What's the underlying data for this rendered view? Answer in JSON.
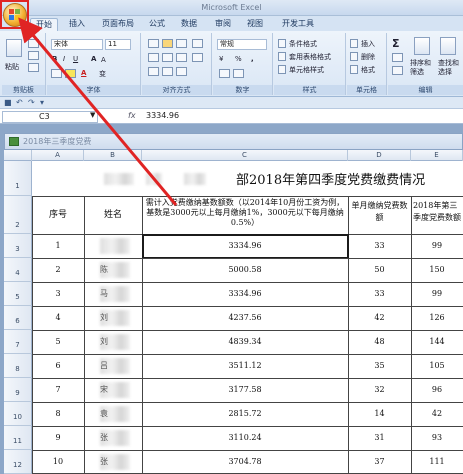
{
  "window": {
    "title": "Microsoft Excel"
  },
  "tabs": [
    "开始",
    "插入",
    "页面布局",
    "公式",
    "数据",
    "审阅",
    "视图",
    "开发工具"
  ],
  "ribbon": {
    "clipboard": {
      "label": "剪贴板",
      "paste": "粘贴"
    },
    "font": {
      "label": "字体",
      "name": "宋体",
      "size": "11",
      "bold": "B",
      "italic": "I",
      "underline": "U",
      "color_letter": "A",
      "grow": "A",
      "shrink": "A",
      "wen": "变"
    },
    "alignment": {
      "label": "对齐方式"
    },
    "number": {
      "label": "数字",
      "format": "常规",
      "currency": "¥",
      "percent": "%",
      "comma": ","
    },
    "styles": {
      "label": "样式",
      "conditional": "条件格式",
      "table": "套用表格格式",
      "cell_styles": "单元格样式"
    },
    "cells": {
      "label": "单元格",
      "insert": "插入",
      "delete": "删除",
      "format": "格式"
    },
    "editing": {
      "label": "编辑",
      "sort": "排序和筛选",
      "find": "查找和选择",
      "sigma": "Σ"
    }
  },
  "formula_bar": {
    "name_box": "C3",
    "fx": "fx",
    "value": "3334.96"
  },
  "workbook": {
    "title": "2018年三季度党费"
  },
  "columns": [
    "A",
    "B",
    "C",
    "D",
    "E"
  ],
  "rows": [
    "1",
    "2",
    "3",
    "4",
    "5",
    "6",
    "7",
    "8",
    "9",
    "10",
    "11",
    "12"
  ],
  "sheet": {
    "title_visible": "部2018年第四季度党费缴费情况",
    "header": {
      "a": "序号",
      "b": "姓名",
      "c": "需计入党费缴纳基数额数（以2014年10月份工资为例，基数是3000元以上每月缴纳1%，3000元以下每月缴纳0.5%）",
      "d": "单月缴纳党费数额",
      "e": "2018年第三季度党费数额"
    },
    "records": [
      {
        "no": "1",
        "name": "",
        "base": "3334.96",
        "monthly": "33",
        "quarter": "99"
      },
      {
        "no": "2",
        "name": "陈",
        "base": "5000.58",
        "monthly": "50",
        "quarter": "150"
      },
      {
        "no": "3",
        "name": "马",
        "base": "3334.96",
        "monthly": "33",
        "quarter": "99"
      },
      {
        "no": "4",
        "name": "刘",
        "base": "4237.56",
        "monthly": "42",
        "quarter": "126"
      },
      {
        "no": "5",
        "name": "刘",
        "base": "4839.34",
        "monthly": "48",
        "quarter": "144"
      },
      {
        "no": "6",
        "name": "吕",
        "base": "3511.12",
        "monthly": "35",
        "quarter": "105"
      },
      {
        "no": "7",
        "name": "宋",
        "base": "3177.58",
        "monthly": "32",
        "quarter": "96"
      },
      {
        "no": "8",
        "name": "袁",
        "base": "2815.72",
        "monthly": "14",
        "quarter": "42"
      },
      {
        "no": "9",
        "name": "张",
        "base": "3110.24",
        "monthly": "31",
        "quarter": "93"
      },
      {
        "no": "10",
        "name": "张",
        "base": "3704.78",
        "monthly": "37",
        "quarter": "111"
      }
    ]
  },
  "colors": {
    "highlight": "#e02424",
    "ribbon_bg": "#d9e6f5"
  }
}
